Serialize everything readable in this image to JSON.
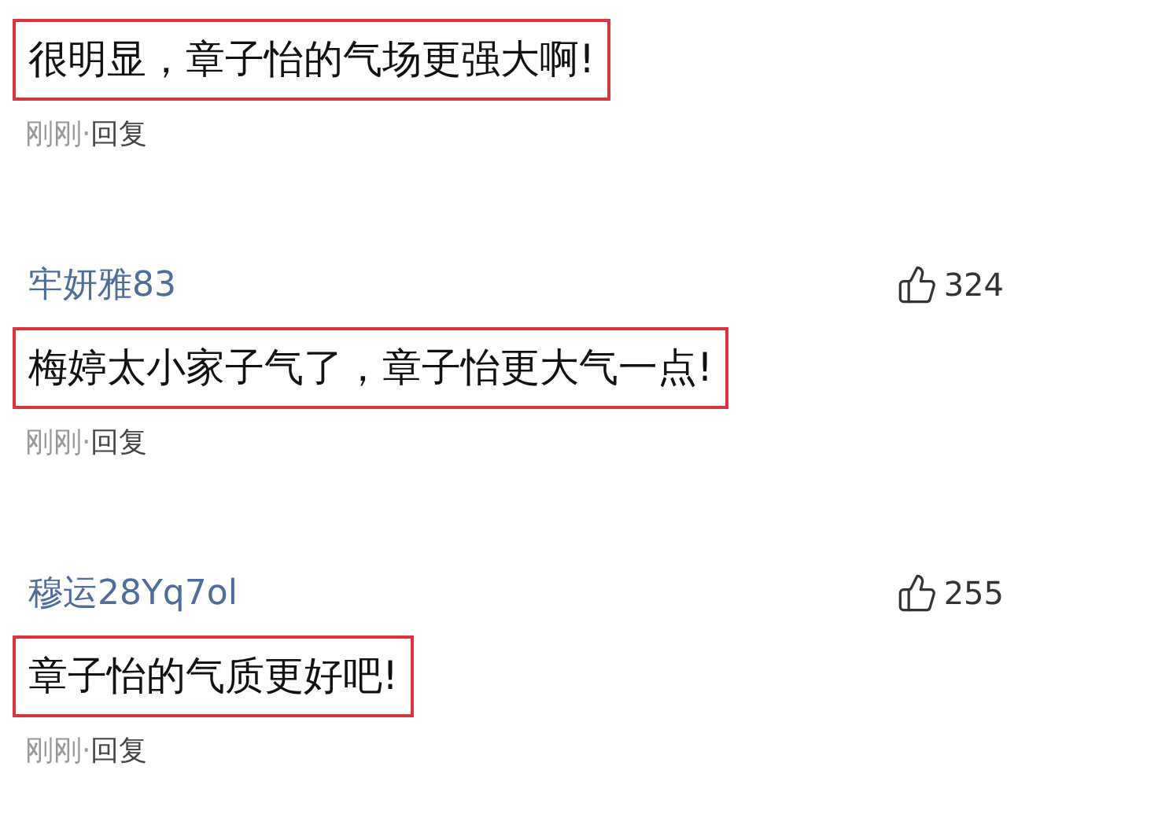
{
  "comments": [
    {
      "text": "很明显，章子怡的气场更强大啊!",
      "highlighted": true,
      "time": "刚刚",
      "separator": "·",
      "reply": "回复"
    },
    {
      "username": "牢妍雅83",
      "likes": "324",
      "text": "梅婷太小家子气了，章子怡更大气一点!",
      "highlighted": true,
      "time": "刚刚",
      "separator": "·",
      "reply": "回复"
    },
    {
      "username": "穆运28Yq7ol",
      "likes": "255",
      "text": "章子怡的气质更好吧!",
      "highlighted": true,
      "time": "刚刚",
      "separator": "·",
      "reply": "回复"
    }
  ]
}
